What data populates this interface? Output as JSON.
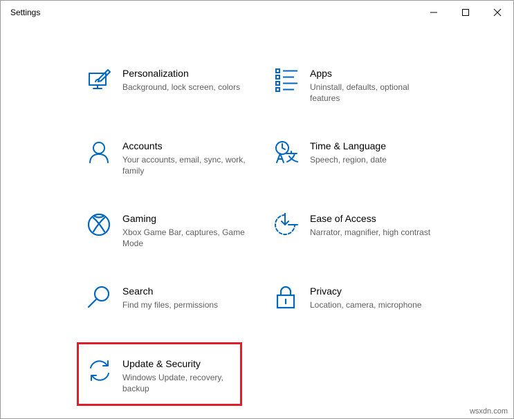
{
  "window": {
    "title": "Settings"
  },
  "tiles": [
    {
      "name": "Personalization",
      "desc": "Background, lock screen, colors",
      "icon": "personalization-icon"
    },
    {
      "name": "Apps",
      "desc": "Uninstall, defaults, optional features",
      "icon": "apps-icon"
    },
    {
      "name": "Accounts",
      "desc": "Your accounts, email, sync, work, family",
      "icon": "accounts-icon"
    },
    {
      "name": "Time & Language",
      "desc": "Speech, region, date",
      "icon": "time-language-icon"
    },
    {
      "name": "Gaming",
      "desc": "Xbox Game Bar, captures, Game Mode",
      "icon": "xbox-icon"
    },
    {
      "name": "Ease of Access",
      "desc": "Narrator, magnifier, high contrast",
      "icon": "ease-of-access-icon"
    },
    {
      "name": "Search",
      "desc": "Find my files, permissions",
      "icon": "search-icon"
    },
    {
      "name": "Privacy",
      "desc": "Location, camera, microphone",
      "icon": "lock-icon"
    },
    {
      "name": "Update & Security",
      "desc": "Windows Update, recovery, backup",
      "icon": "sync-icon"
    }
  ],
  "colors": {
    "accent": "#0067c0",
    "highlight": "#e21d2a"
  },
  "watermark": "wsxdn.com"
}
